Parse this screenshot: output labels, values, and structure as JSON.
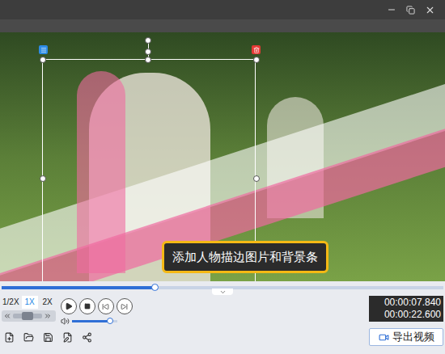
{
  "preview": {
    "caption": "添加人物描边图片和背景条",
    "selection": true
  },
  "timeline": {
    "level": 0.347
  },
  "speeds": [
    {
      "label": "1/2X",
      "selected": false
    },
    {
      "label": "1X",
      "selected": true
    },
    {
      "label": "2X",
      "selected": false
    }
  ],
  "seek": {
    "level": 0.5
  },
  "volume": {
    "level": 0.85
  },
  "time": {
    "current": "00:00:07.840",
    "total": "00:00:22.600"
  },
  "export": {
    "label": "导出视频"
  }
}
